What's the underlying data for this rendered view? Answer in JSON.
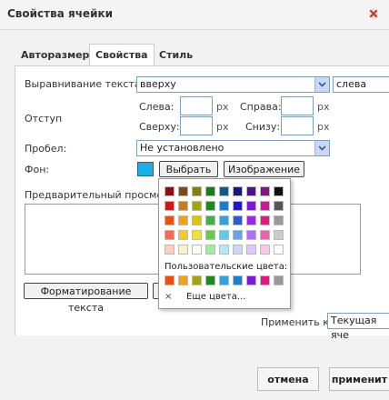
{
  "dialog": {
    "title": "Свойства ячейки"
  },
  "tabs": [
    {
      "label": "Авторазмер"
    },
    {
      "label": "Свойства"
    },
    {
      "label": "Стиль"
    }
  ],
  "alignment": {
    "label": "Выравнивание текста:",
    "vertical": "вверху",
    "horizontal": "слева"
  },
  "padding": {
    "label": "Отступ",
    "left_label": "Слева:",
    "right_label": "Справа:",
    "top_label": "Сверху:",
    "bottom_label": "Снизу:",
    "unit": "px",
    "left_value": "",
    "right_value": "",
    "top_value": "",
    "bottom_value": ""
  },
  "spacing": {
    "label": "Пробел:",
    "value": "Не установлено"
  },
  "background": {
    "label": "Фон:",
    "color": "#1ab2e6",
    "choose_label": "Выбрать",
    "image_label": "Изображение"
  },
  "preview": {
    "label": "Предварительный просмотр:"
  },
  "format_text_label": "Форматирование текста",
  "apply": {
    "label": "Применить к:",
    "value": "Текущая яче"
  },
  "palette": {
    "rows": [
      [
        "#7f1717",
        "#7f4a17",
        "#7f7f17",
        "#177f17",
        "#17597f",
        "#17177f",
        "#4a177f",
        "#7f177f",
        "#111111"
      ],
      [
        "#cc1a1a",
        "#cc7a1a",
        "#a3a31a",
        "#1a8c1a",
        "#1a7fcc",
        "#1a1acc",
        "#7a1acc",
        "#cc1a99",
        "#555555"
      ],
      [
        "#e8501a",
        "#f0a01a",
        "#d9c21a",
        "#44b044",
        "#3aa0d8",
        "#2a5adc",
        "#9a2ae0",
        "#e01a80",
        "#999999"
      ],
      [
        "#f06a5a",
        "#f5c830",
        "#f0e040",
        "#66cc44",
        "#66c8e8",
        "#6aa0f0",
        "#b070f0",
        "#f060b0",
        "#cccccc"
      ],
      [
        "#f8d0c0",
        "#fff0c8",
        "#fffff0",
        "#99ee99",
        "#b8e8f8",
        "#c8d8f8",
        "#e0c8f8",
        "#f8c8e8",
        "#ffffff"
      ]
    ],
    "custom_label": "Пользовательские цвета:",
    "custom": [
      "#e8501a",
      "#f0a01a",
      "#a3a31a",
      "#1a8c1a",
      "#3aa0d8",
      "#1a7fcc",
      "#7a1acc",
      "#e01a80",
      "#999999"
    ],
    "more_label": "Еще цвета...",
    "close_glyph": "×"
  },
  "footer": {
    "cancel_label": "отмена",
    "apply_label": "применит"
  }
}
